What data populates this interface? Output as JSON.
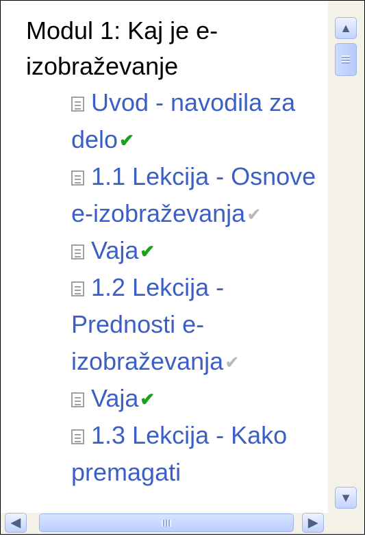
{
  "module": {
    "title": "Modul 1: Kaj je e-izobraževanje"
  },
  "lessons": [
    {
      "text": "Uvod - navodila za delo",
      "status": "done"
    },
    {
      "text": "1.1 Lekcija - Osnove e-izobraževanja",
      "status": "partial"
    },
    {
      "text": "Vaja",
      "status": "done"
    },
    {
      "text": "1.2 Lekcija - Prednosti e-izobraževanja",
      "status": "partial"
    },
    {
      "text": "Vaja",
      "status": "done"
    },
    {
      "text": "1.3 Lekcija - Kako premagati",
      "status": "none"
    }
  ],
  "scrollbars": {
    "vertical": {
      "up_icon": "arrow-up-icon",
      "down_icon": "arrow-down-icon",
      "position": 0.0
    },
    "horizontal": {
      "left_icon": "arrow-left-icon",
      "right_icon": "arrow-right-icon",
      "position": 0.0
    }
  },
  "colors": {
    "link": "#3b5fc4",
    "check_done": "#1aa01a",
    "check_partial": "#b9b9b9",
    "scrollbar_track": "#f4f2e8"
  }
}
